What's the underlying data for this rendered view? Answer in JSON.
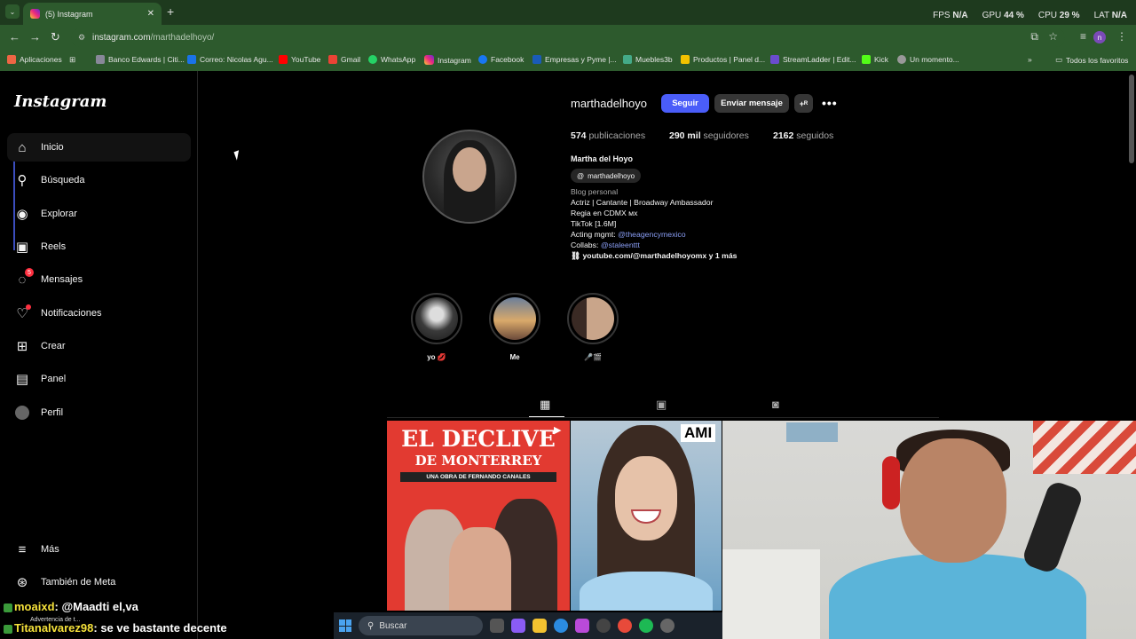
{
  "browser": {
    "tab_title": "(5) Instagram",
    "url_host": "instagram.com",
    "url_path": "/marthadelhoyo/",
    "perf": {
      "fps_label": "FPS",
      "fps_value": "N/A",
      "gpu_label": "GPU",
      "gpu_value": "44 %",
      "cpu_label": "CPU",
      "cpu_value": "29 %",
      "lat_label": "LAT",
      "lat_value": "N/A"
    },
    "bookmarks": [
      "Aplicaciones",
      "Banco Edwards | Citi...",
      "Correo: Nicolas Agu...",
      "YouTube",
      "Gmail",
      "WhatsApp",
      "Instagram",
      "Facebook",
      "Empresas y Pyme |...",
      "Muebles3b",
      "Productos | Panel d...",
      "StreamLadder | Edit...",
      "Kick",
      "Un momento..."
    ],
    "all_favorites": "Todos los favoritos",
    "avatar_initial": "n"
  },
  "instagram": {
    "logo": "Instagram",
    "nav": [
      {
        "label": "Inicio",
        "icon": "home-icon"
      },
      {
        "label": "Búsqueda",
        "icon": "search-icon"
      },
      {
        "label": "Explorar",
        "icon": "compass-icon"
      },
      {
        "label": "Reels",
        "icon": "reels-icon"
      },
      {
        "label": "Mensajes",
        "icon": "messenger-icon",
        "badge": "5"
      },
      {
        "label": "Notificaciones",
        "icon": "heart-icon"
      },
      {
        "label": "Crear",
        "icon": "plus-icon"
      },
      {
        "label": "Panel",
        "icon": "chart-icon"
      },
      {
        "label": "Perfil",
        "icon": "avatar-icon"
      }
    ],
    "more": "Más",
    "meta": "También de Meta"
  },
  "profile": {
    "username": "marthadelhoyo",
    "follow_label": "Seguir",
    "message_label": "Enviar mensaje",
    "posts_count": "574",
    "posts_label": "publicaciones",
    "followers_count": "290 mil",
    "followers_label": "seguidores",
    "following_count": "2162",
    "following_label": "seguidos",
    "full_name": "Martha del Hoyo",
    "threads_handle": "marthadelhoyo",
    "category": "Blog personal",
    "bio_line1": "Actriz | Cantante | Broadway Ambassador",
    "bio_line2": "Regia en CDMX ᴍx",
    "bio_line3": "TikTok [1.6M]",
    "bio_acting_prefix": "Acting mgmt: ",
    "bio_acting_link": "@theagencymexico",
    "bio_collabs_prefix": "Collabs: ",
    "bio_collabs_link": "@staleenttt",
    "bio_url": "youtube.com/@marthadelhoyomx y 1 más",
    "highlights": [
      {
        "label": "yo 💋"
      },
      {
        "label": "Me"
      },
      {
        "label": "🎤🎬"
      }
    ]
  },
  "posts": {
    "post1_title1": "EL DECLIVE",
    "post1_title2": "DE MONTERREY",
    "post1_subtitle": "UNA OBRA DE FERNANDO CANALES",
    "post2_overlay": "AMI"
  },
  "stream": {
    "chat": [
      {
        "user": "moaixd",
        "message": ": @Maadti el,va"
      },
      {
        "user": "Titanalvarez98",
        "message": ": se ve bastante decente"
      }
    ],
    "warning": "Advertencia de t...",
    "taskbar_search": "Buscar"
  }
}
